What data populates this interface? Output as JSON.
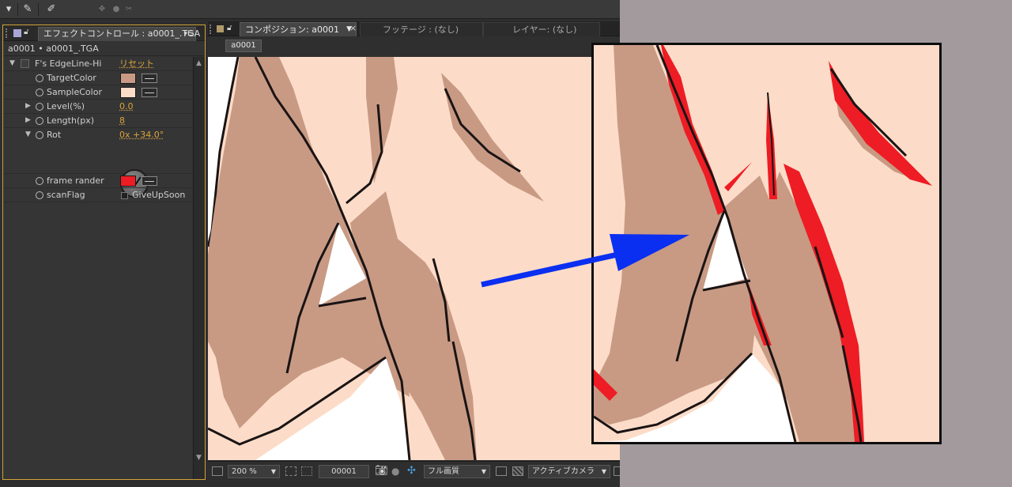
{
  "toolbar": {
    "icons": [
      "chevron-down-icon",
      "brush-icon",
      "pin-icon",
      "orbit-icon",
      "circle-icon",
      "scissors-icon"
    ]
  },
  "effect_controls": {
    "tab_label": "エフェクトコントロール : a0001_.TGA",
    "menu_glyph": "▾☰",
    "breadcrumb": "a0001 • a0001_.TGA",
    "effect_name": "F's EdgeLine-Hi",
    "reset_label": "リセット",
    "properties": [
      {
        "name": "TargetColor",
        "color": "#c89a84",
        "has_eyedropper": true
      },
      {
        "name": "SampleColor",
        "color": "#fcdcc8",
        "has_eyedropper": true
      },
      {
        "name": "Level(%)",
        "value": "0.0"
      },
      {
        "name": "Length(px)",
        "value": "8"
      },
      {
        "name": "Rot",
        "value": "0x +34.0°"
      },
      {
        "name": "frame rander",
        "color": "#ee1c24",
        "has_eyedropper": true
      },
      {
        "name": "scanFlag",
        "checkbox_label": "GiveUpSoon",
        "checked": false
      }
    ]
  },
  "composition": {
    "tabs": [
      {
        "label": "コンポジション: a0001",
        "active": true
      },
      {
        "label": "フッテージ : (なし)",
        "active": false
      },
      {
        "label": "レイヤー: (なし)",
        "active": false
      }
    ],
    "comp_chip": "a0001",
    "bottom_bar": {
      "zoom": "200 %",
      "timecode": "00001",
      "resolution": "フル画質",
      "camera": "アクティブカメラ"
    }
  },
  "colors": {
    "skin": "#fcdcc8",
    "shadow": "#c89a84",
    "line": "#1a1414",
    "highlight_red": "#ee1c24",
    "arrow_blue": "#0a2ff0",
    "accent_orange": "#d8a43c"
  }
}
